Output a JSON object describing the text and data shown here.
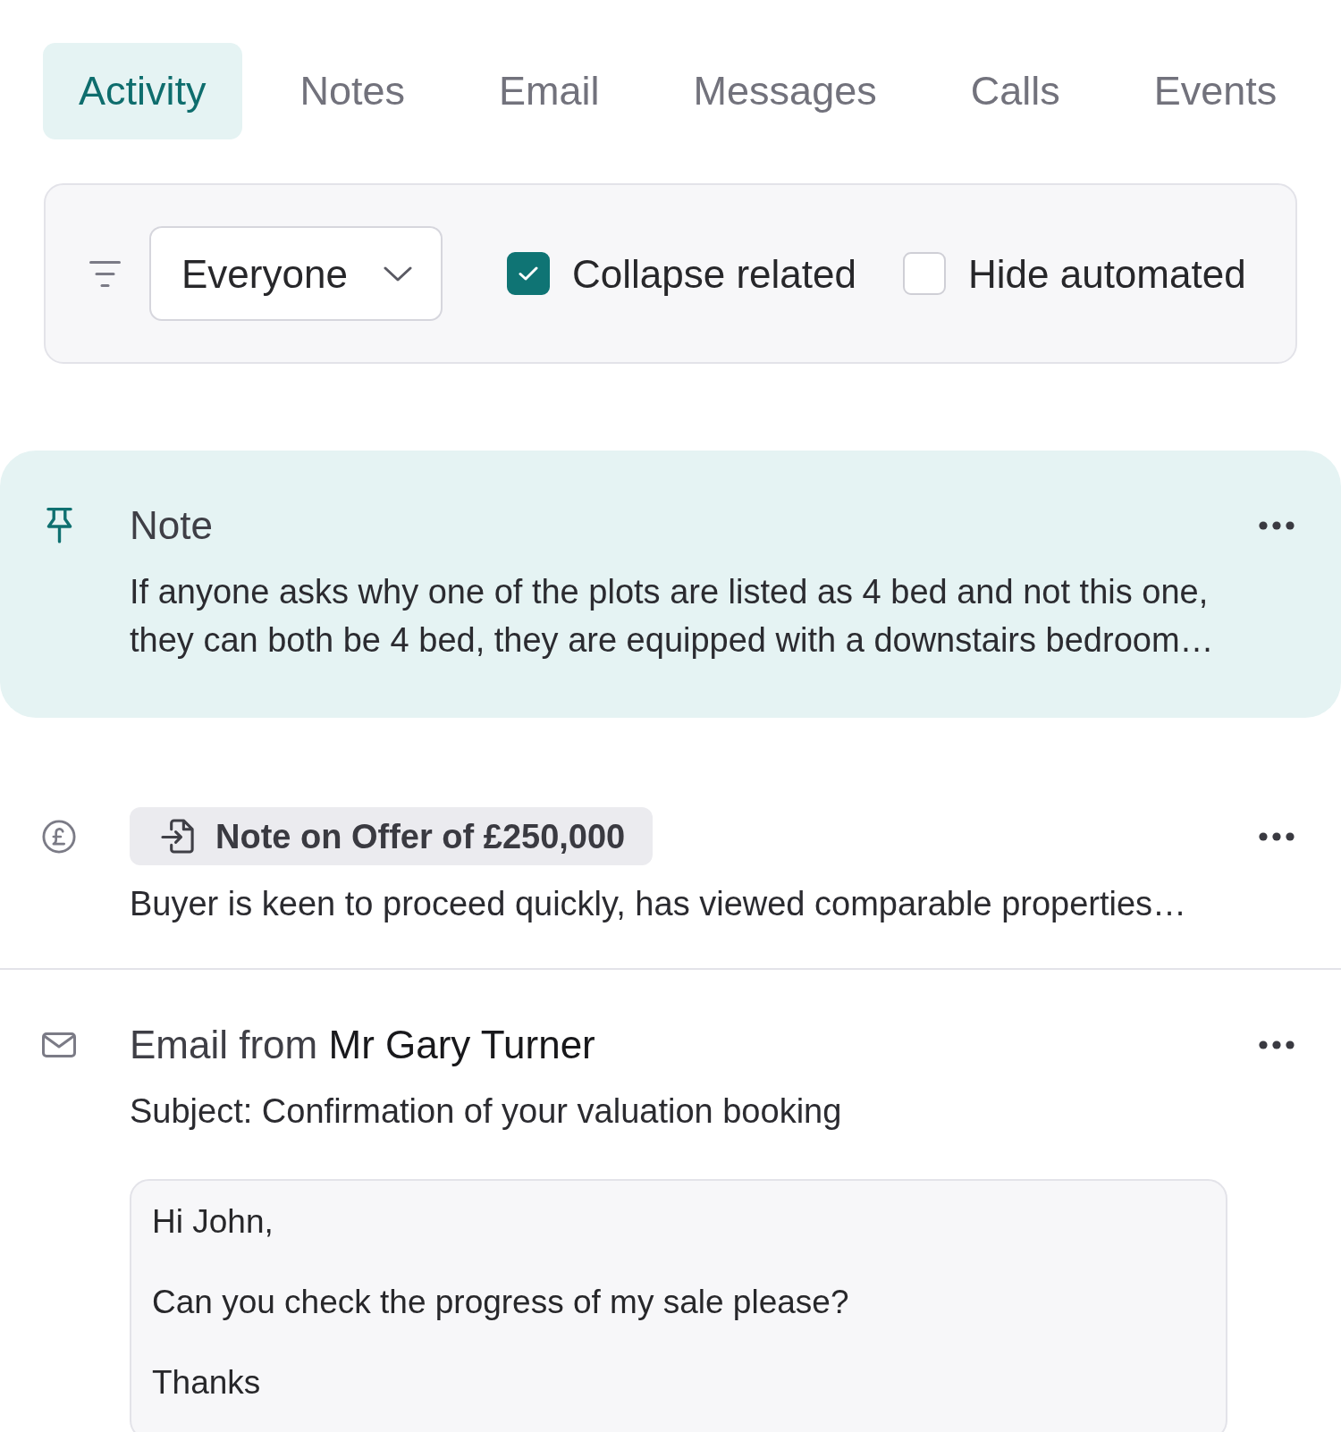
{
  "tabs": [
    {
      "label": "Activity",
      "selected": true
    },
    {
      "label": "Notes",
      "selected": false
    },
    {
      "label": "Email",
      "selected": false
    },
    {
      "label": "Messages",
      "selected": false
    },
    {
      "label": "Calls",
      "selected": false
    },
    {
      "label": "Events",
      "selected": false
    }
  ],
  "filter_bar": {
    "dropdown": {
      "value": "Everyone"
    },
    "checkboxes": [
      {
        "label": "Collapse related",
        "checked": true
      },
      {
        "label": "Hide automated",
        "checked": false
      }
    ]
  },
  "feed": [
    {
      "kind": "note",
      "pinned": true,
      "title": "Note",
      "body": "If anyone asks why one of the plots are listed as 4 bed and not this one, they can both be 4 bed, they are equipped with a downstairs bedroom…"
    },
    {
      "kind": "offer",
      "pinned": false,
      "tag": "Note on Offer of £250,000",
      "body": "Buyer is keen to proceed quickly, has viewed comparable properties…"
    },
    {
      "kind": "email",
      "pinned": false,
      "title": "Email from **Mr Gary Turner**",
      "subject": "Subject: Confirmation of your valuation booking",
      "message": [
        "Hi John,",
        "Can you check the progress of my sale please?",
        "Thanks"
      ]
    }
  ]
}
